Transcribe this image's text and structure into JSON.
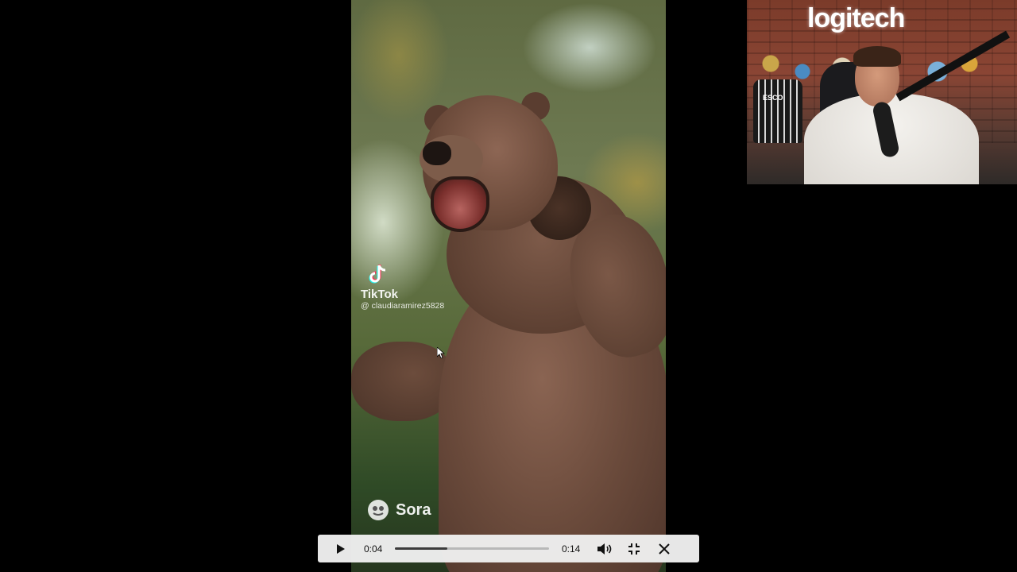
{
  "video": {
    "tiktok_label": "TikTok",
    "tiktok_handle": "@ claudiaramirez5828",
    "sora_label": "Sora"
  },
  "webcam": {
    "brand_sign": "logitech",
    "jersey_text": "ESCO"
  },
  "player": {
    "current_time": "0:04",
    "total_time": "0:14",
    "progress_fraction": 0.34,
    "play_icon": "play-icon",
    "volume_icon": "volume-icon",
    "exit_fullscreen_icon": "exit-fullscreen-icon",
    "close_icon": "close-icon"
  },
  "colors": {
    "control_bar": "#eeeeee",
    "progress_fill": "#3c3c3c",
    "progress_track": "#b8b8b8"
  }
}
